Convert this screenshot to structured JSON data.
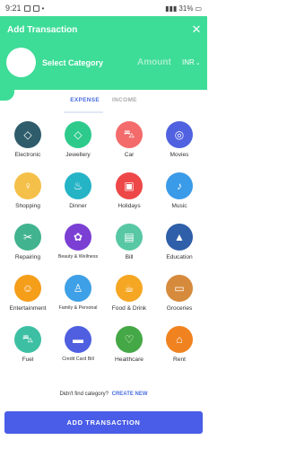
{
  "status": {
    "time": "9:21",
    "battery": "31%"
  },
  "header": {
    "title": "Add Transaction",
    "select_category": "Select Category",
    "amount_placeholder": "Amount",
    "currency": "INR"
  },
  "tabs": [
    {
      "label": "EXPENSE",
      "active": true
    },
    {
      "label": "INCOME",
      "active": false
    }
  ],
  "categories": [
    {
      "label": "Electronic",
      "icon": "diamond-icon",
      "color": "#2e5c6b"
    },
    {
      "label": "Jewellery",
      "icon": "diamond-icon",
      "color": "#2dca8c"
    },
    {
      "label": "Car",
      "icon": "car-icon",
      "color": "#f36b6b"
    },
    {
      "label": "Movies",
      "icon": "movie-icon",
      "color": "#5062e0"
    },
    {
      "label": "Shopping",
      "icon": "dress-icon",
      "color": "#f5c04a"
    },
    {
      "label": "Dinner",
      "icon": "dinner-icon",
      "color": "#25b4c6"
    },
    {
      "label": "Holidays",
      "icon": "luggage-icon",
      "color": "#ee4747"
    },
    {
      "label": "Music",
      "icon": "music-icon",
      "color": "#3a9be8"
    },
    {
      "label": "Repairing",
      "icon": "tools-icon",
      "color": "#41b38e"
    },
    {
      "label": "Beauty & Wellness",
      "icon": "lotus-icon",
      "color": "#7b3fd4"
    },
    {
      "label": "Bill",
      "icon": "bill-icon",
      "color": "#58c7a4"
    },
    {
      "label": "Education",
      "icon": "graduation-icon",
      "color": "#2f5fa8"
    },
    {
      "label": "Entertainment",
      "icon": "masks-icon",
      "color": "#f59e1a"
    },
    {
      "label": "Family & Personal",
      "icon": "family-icon",
      "color": "#3ea0e6"
    },
    {
      "label": "Food & Drink",
      "icon": "food-icon",
      "color": "#f5a623"
    },
    {
      "label": "Groceries",
      "icon": "basket-icon",
      "color": "#d68b3c"
    },
    {
      "label": "Fuel",
      "icon": "car-icon",
      "color": "#3dbfa3"
    },
    {
      "label": "Credit Card Bill",
      "icon": "card-icon",
      "color": "#4f5fe0"
    },
    {
      "label": "Healthcare",
      "icon": "heart-icon",
      "color": "#45a846"
    },
    {
      "label": "Rent",
      "icon": "home-icon",
      "color": "#f0831f"
    }
  ],
  "footer": {
    "find_text": "Didn't find category?",
    "create_new": "CREATE NEW",
    "add_button": "ADD TRANSACTION"
  }
}
